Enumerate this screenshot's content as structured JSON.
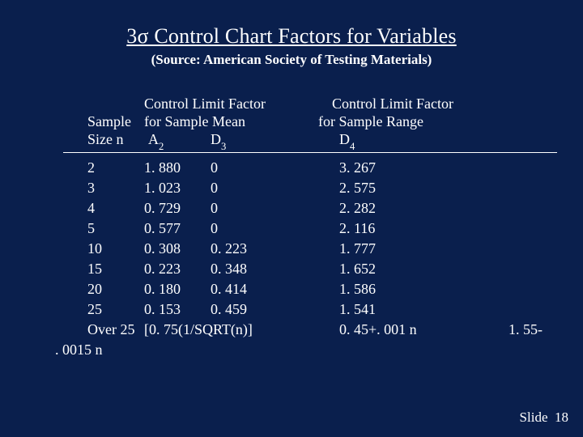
{
  "title": "3σ Control Chart Factors for Variables",
  "subtitle": "(Source:  American Society of Testing Materials)",
  "headers": {
    "sample": "Sample",
    "sizen": "Size n",
    "clf1a": "Control Limit Factor",
    "clf1b": "for Sample Mean",
    "a2_prefix": "A",
    "a2_sub": "2",
    "d3_prefix": "D",
    "d3_sub": "3",
    "clf2a": "Control Limit Factor",
    "clf2b": "for Sample Range",
    "d4_prefix": "D",
    "d4_sub": "4"
  },
  "rows": [
    {
      "n": "2",
      "a2": "1. 880",
      "d3": "0",
      "d4": "3. 267"
    },
    {
      "n": "3",
      "a2": "1. 023",
      "d3": "0",
      "d4": "2. 575"
    },
    {
      "n": "4",
      "a2": "0. 729",
      "d3": "0",
      "d4": "2. 282"
    },
    {
      "n": "5",
      "a2": "0. 577",
      "d3": "0",
      "d4": "2. 116"
    },
    {
      "n": "10",
      "a2": "0. 308",
      "d3": "0. 223",
      "d4": "1. 777"
    },
    {
      "n": "15",
      "a2": "0. 223",
      "d3": "0. 348",
      "d4": "1. 652"
    },
    {
      "n": "20",
      "a2": "0. 180",
      "d3": "0. 414",
      "d4": "1. 586"
    },
    {
      "n": "25",
      "a2": "0. 153",
      "d3": "0. 459",
      "d4": "1. 541"
    }
  ],
  "overRow": {
    "n": "Over 25",
    "a2d3": "[0. 75(1/SQRT(n)]",
    "d4": "0. 45+. 001 n",
    "right": "1. 55-"
  },
  "footnote": ". 0015 n",
  "slideLabel": "Slide",
  "slideNumber": "18",
  "chart_data": {
    "type": "table",
    "title": "3σ Control Chart Factors for Variables",
    "source": "American Society of Testing Materials",
    "columns": [
      "Sample Size n",
      "A2 (Control Limit Factor for Sample Mean)",
      "D3 (Control Limit Factor for Sample Range, lower)",
      "D4 (Control Limit Factor for Sample Range, upper)"
    ],
    "data": [
      {
        "n": 2,
        "A2": 1.88,
        "D3": 0,
        "D4": 3.267
      },
      {
        "n": 3,
        "A2": 1.023,
        "D3": 0,
        "D4": 2.575
      },
      {
        "n": 4,
        "A2": 0.729,
        "D3": 0,
        "D4": 2.282
      },
      {
        "n": 5,
        "A2": 0.577,
        "D3": 0,
        "D4": 2.116
      },
      {
        "n": 10,
        "A2": 0.308,
        "D3": 0.223,
        "D4": 1.777
      },
      {
        "n": 15,
        "A2": 0.223,
        "D3": 0.348,
        "D4": 1.652
      },
      {
        "n": 20,
        "A2": 0.18,
        "D3": 0.414,
        "D4": 1.586
      },
      {
        "n": 25,
        "A2": 0.153,
        "D3": 0.459,
        "D4": 1.541
      },
      {
        "n": "Over 25",
        "A2_D3": "0.75(1/SQRT(n))",
        "D4": "0.45 + 0.001n   and   1.55 - 0.0015n"
      }
    ]
  }
}
